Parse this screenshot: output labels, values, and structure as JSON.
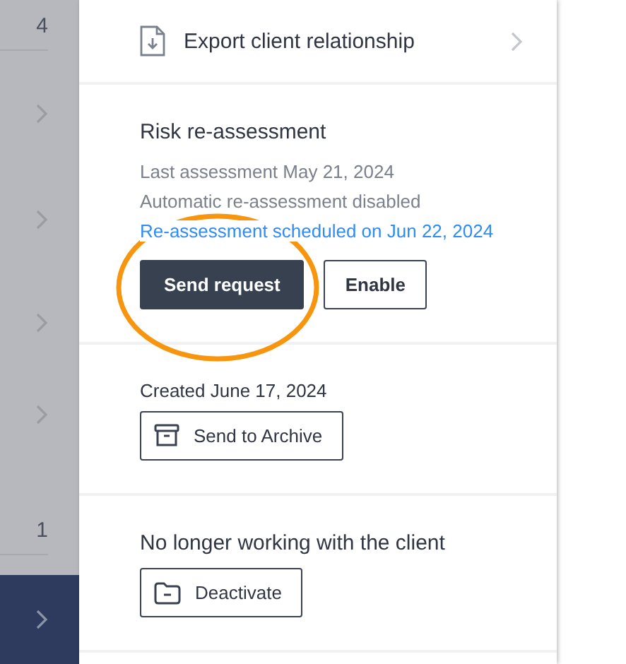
{
  "background_rows": [
    {
      "kind": "count",
      "text": "4",
      "selected": false
    },
    {
      "kind": "chevron",
      "selected": false
    },
    {
      "kind": "chevron",
      "selected": false
    },
    {
      "kind": "chevron",
      "selected": false
    },
    {
      "kind": "chevron",
      "selected": false
    },
    {
      "kind": "count",
      "text": "1",
      "selected": false
    },
    {
      "kind": "chevron",
      "selected": true
    }
  ],
  "panel": {
    "export_row": {
      "label": "Export client relationship"
    },
    "sections": [
      {
        "title": "Risk re-assessment",
        "lines": [
          "Last assessment May 21, 2024",
          "Automatic re-assessment disabled"
        ],
        "link": "Re-assessment scheduled on Jun 22, 2024",
        "buttons": [
          {
            "kind": "primary",
            "label": "Send request",
            "annotated": true
          },
          {
            "kind": "outline",
            "label": "Enable",
            "annotated": false
          }
        ]
      },
      {
        "note": "Created June 17, 2024",
        "buttons": [
          {
            "kind": "archive",
            "label": "Send to Archive",
            "annotated": false
          }
        ]
      },
      {
        "title": "No longer working with the client",
        "buttons": [
          {
            "kind": "deactivate",
            "label": "Deactivate",
            "annotated": false
          }
        ]
      }
    ]
  }
}
